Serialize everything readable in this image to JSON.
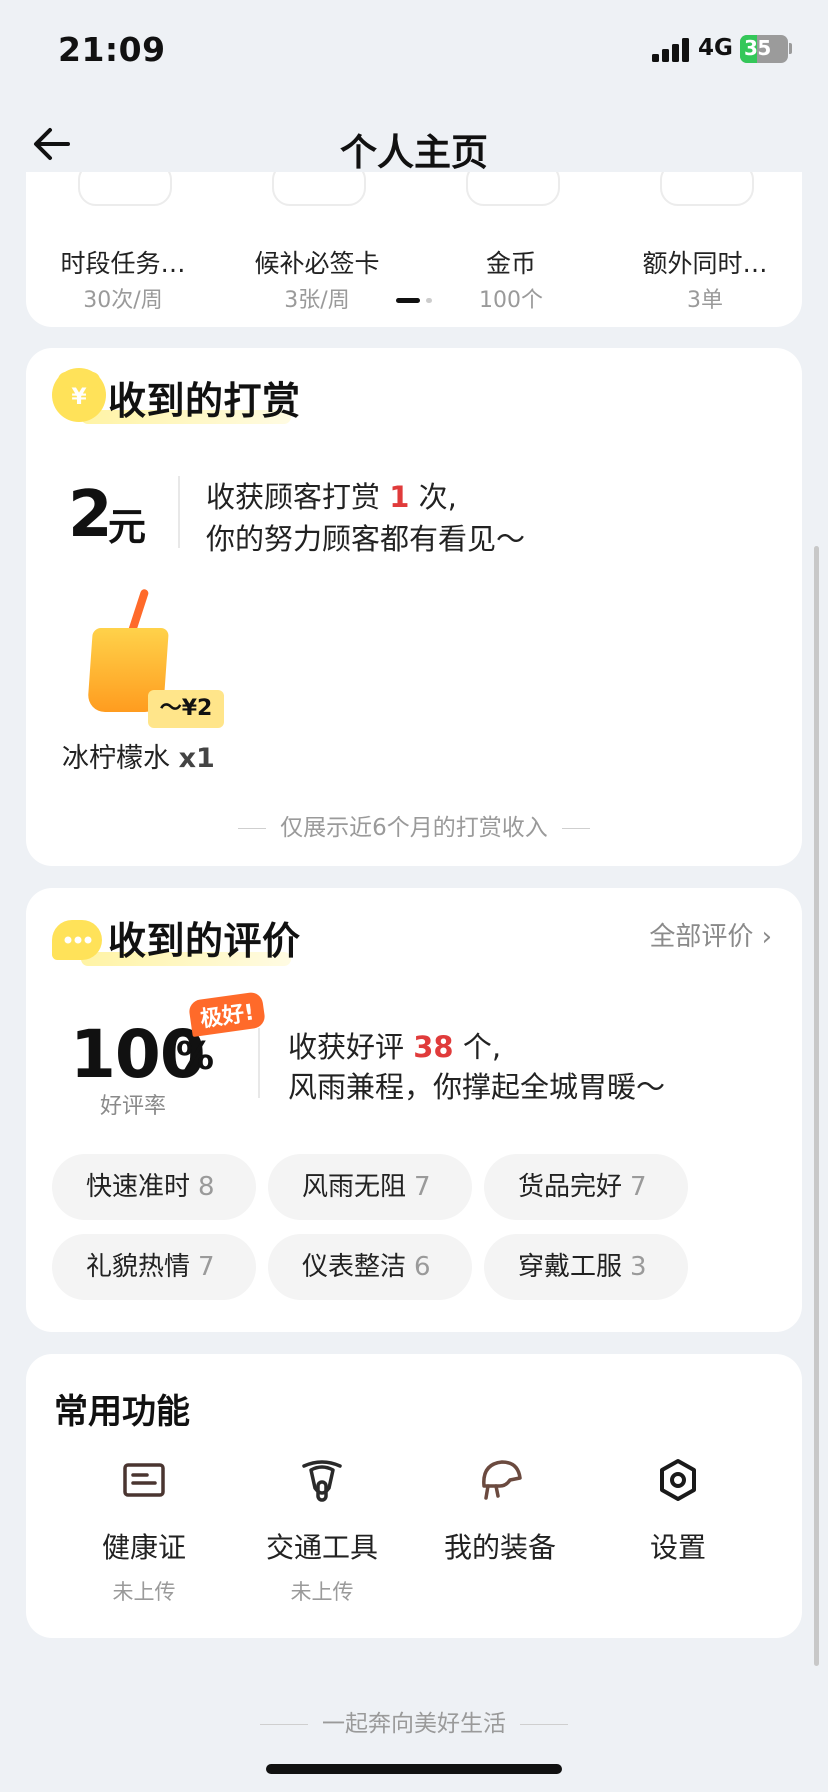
{
  "status": {
    "time": "21:09",
    "network": "4G",
    "battery": "35",
    "battery_level": 0.35
  },
  "nav": {
    "title": "个人主页"
  },
  "benefits": [
    {
      "name": "时段任务…",
      "sub": "30次/周"
    },
    {
      "name": "候补必签卡",
      "sub": "3张/周"
    },
    {
      "name": "金币",
      "sub": "100个"
    },
    {
      "name": "额外同时…",
      "sub": "3单"
    }
  ],
  "reward": {
    "title": "收到的打赏",
    "amount": "2",
    "unit": "元",
    "line1_prefix": "收获顾客打赏",
    "count": "1",
    "line1_suffix": "次,",
    "line2": "你的努力顾客都有看见～",
    "gift_price": "～¥2",
    "gift_name": "冰柠檬水",
    "gift_qty": "x1",
    "footnote": "仅展示近6个月的打赏收入"
  },
  "reviews": {
    "title": "收到的评价",
    "all_link": "全部评价 ›",
    "rate": "100",
    "rate_sign": "%",
    "badge": "极好!",
    "rate_label": "好评率",
    "line1_prefix": "收获好评",
    "count": "38",
    "line1_suffix": "个,",
    "line2": "风雨兼程，你撑起全城胃暖～",
    "tags": [
      {
        "label": "快速准时",
        "count": "8"
      },
      {
        "label": "风雨无阻",
        "count": "7"
      },
      {
        "label": "货品完好",
        "count": "7"
      },
      {
        "label": "礼貌热情",
        "count": "7"
      },
      {
        "label": "仪表整洁",
        "count": "6"
      },
      {
        "label": "穿戴工服",
        "count": "3"
      }
    ]
  },
  "functions": {
    "title": "常用功能",
    "items": [
      {
        "name": "健康证",
        "sub": "未上传",
        "icon": "id-card-icon"
      },
      {
        "name": "交通工具",
        "sub": "未上传",
        "icon": "scooter-icon"
      },
      {
        "name": "我的装备",
        "sub": "",
        "icon": "helmet-icon"
      },
      {
        "name": "设置",
        "sub": "",
        "icon": "gear-icon"
      }
    ]
  },
  "footer": {
    "slogan": "一起奔向美好生活"
  }
}
